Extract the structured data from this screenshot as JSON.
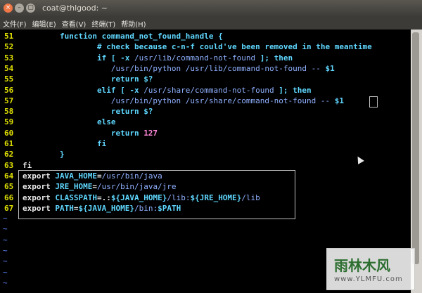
{
  "window": {
    "title": "coat@thlgood: ~",
    "close_glyph": "×",
    "min_glyph": "–",
    "max_glyph": "▢"
  },
  "menu": [
    "文件(F)",
    "编辑(E)",
    "查看(V)",
    "终端(T)",
    "帮助(H)"
  ],
  "lines": [
    {
      "n": "51",
      "segs": [
        [
          "kw",
          "        function command_not_found_handle {"
        ]
      ]
    },
    {
      "n": "52",
      "segs": [
        [
          "cm",
          "                # check because c-n-f could've been removed in the meantime"
        ]
      ]
    },
    {
      "n": "53",
      "segs": [
        [
          "kw",
          "                if [ -x "
        ],
        [
          "path",
          "/usr/lib/command-not-found"
        ],
        [
          "kw",
          " ]; then"
        ]
      ]
    },
    {
      "n": "54",
      "segs": [
        [
          "path",
          "                   /usr/bin/python /usr/lib/command-not-found -- "
        ],
        [
          "var",
          "$1"
        ]
      ]
    },
    {
      "n": "55",
      "segs": [
        [
          "kw",
          "                   return "
        ],
        [
          "var",
          "$?"
        ]
      ]
    },
    {
      "n": "56",
      "segs": [
        [
          "kw",
          "                elif [ -x "
        ],
        [
          "path",
          "/usr/share/command-not-found"
        ],
        [
          "kw",
          " ]; then"
        ]
      ]
    },
    {
      "n": "57",
      "segs": [
        [
          "path",
          "                   /usr/bin/python /usr/share/command-not-found -- "
        ],
        [
          "var",
          "$1"
        ]
      ]
    },
    {
      "n": "58",
      "segs": [
        [
          "kw",
          "                   return "
        ],
        [
          "var",
          "$?"
        ]
      ]
    },
    {
      "n": "59",
      "segs": [
        [
          "kw",
          "                else"
        ]
      ]
    },
    {
      "n": "60",
      "segs": [
        [
          "kw",
          "                   return "
        ],
        [
          "num",
          "127"
        ]
      ]
    },
    {
      "n": "61",
      "segs": [
        [
          "kw",
          "                fi"
        ]
      ]
    },
    {
      "n": "62",
      "segs": [
        [
          "kw",
          "        }"
        ]
      ]
    },
    {
      "n": "63",
      "segs": [
        [
          "white",
          "fi"
        ]
      ]
    },
    {
      "n": "64",
      "segs": [
        [
          "white",
          "export "
        ],
        [
          "kw",
          "JAVA_HOME"
        ],
        [
          "white",
          "="
        ],
        [
          "path",
          "/usr/bin/java"
        ]
      ]
    },
    {
      "n": "65",
      "segs": [
        [
          "white",
          "export "
        ],
        [
          "kw",
          "JRE_HOME"
        ],
        [
          "white",
          "="
        ],
        [
          "path",
          "/usr/bin/java/jre"
        ]
      ]
    },
    {
      "n": "66",
      "segs": [
        [
          "white",
          "export "
        ],
        [
          "kw",
          "CLASSPATH"
        ],
        [
          "white",
          "=.:"
        ],
        [
          "var",
          "${JAVA_HOME}"
        ],
        [
          "path",
          "/lib:"
        ],
        [
          "var",
          "${JRE_HOME}"
        ],
        [
          "path",
          "/lib"
        ]
      ]
    },
    {
      "n": "67",
      "segs": [
        [
          "white",
          "export "
        ],
        [
          "kw",
          "PATH"
        ],
        [
          "white",
          "="
        ],
        [
          "var",
          "${JAVA_HOME}"
        ],
        [
          "path",
          "/bin:"
        ],
        [
          "var",
          "$PATH"
        ]
      ]
    }
  ],
  "tildes": [
    "~",
    "~",
    "~",
    "~",
    "~",
    "~",
    "~"
  ],
  "watermark": {
    "main": "雨林木风",
    "sub": "www.YLMFU.com"
  }
}
